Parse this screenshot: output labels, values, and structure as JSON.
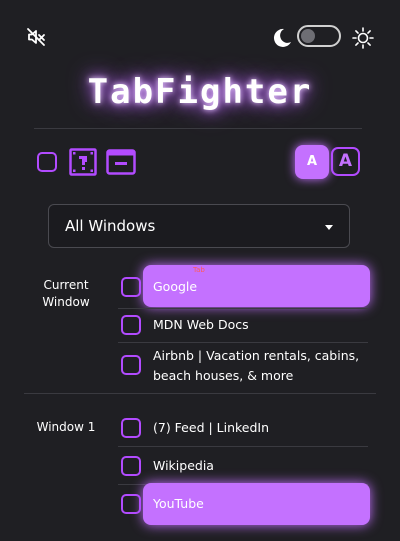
{
  "header": {
    "title": "TabFighter",
    "mute_icon": "volume-mute-icon",
    "moon_icon": "moon-icon",
    "sun_icon": "sun-icon",
    "theme_toggle_on": false
  },
  "toolbar": {
    "select_all_icon": "checkbox-icon",
    "help_icon": "question-block-icon",
    "window_icon": "browser-window-icon",
    "font_small_label": "A",
    "font_large_label": "A"
  },
  "filter": {
    "selected": "All Windows"
  },
  "groups": [
    {
      "label_line1": "Current",
      "label_line2": "Window",
      "tabs": [
        {
          "title": "Google",
          "highlighted": true
        },
        {
          "title": "MDN Web Docs",
          "highlighted": false
        },
        {
          "title_line1": "Airbnb | Vacation rentals, cabins,",
          "title_line2": "beach houses, & more",
          "highlighted": false
        }
      ]
    },
    {
      "label_line1": "Window 1",
      "tabs": [
        {
          "title": "(7) Feed | LinkedIn",
          "highlighted": false
        },
        {
          "title": "Wikipedia",
          "highlighted": false
        },
        {
          "title": "YouTube",
          "highlighted": true
        }
      ]
    }
  ],
  "tooltip": {
    "text": "Tab"
  },
  "colors": {
    "background": "#1f1f23",
    "accent": "#c471ff",
    "accent_border": "#b24bff"
  }
}
